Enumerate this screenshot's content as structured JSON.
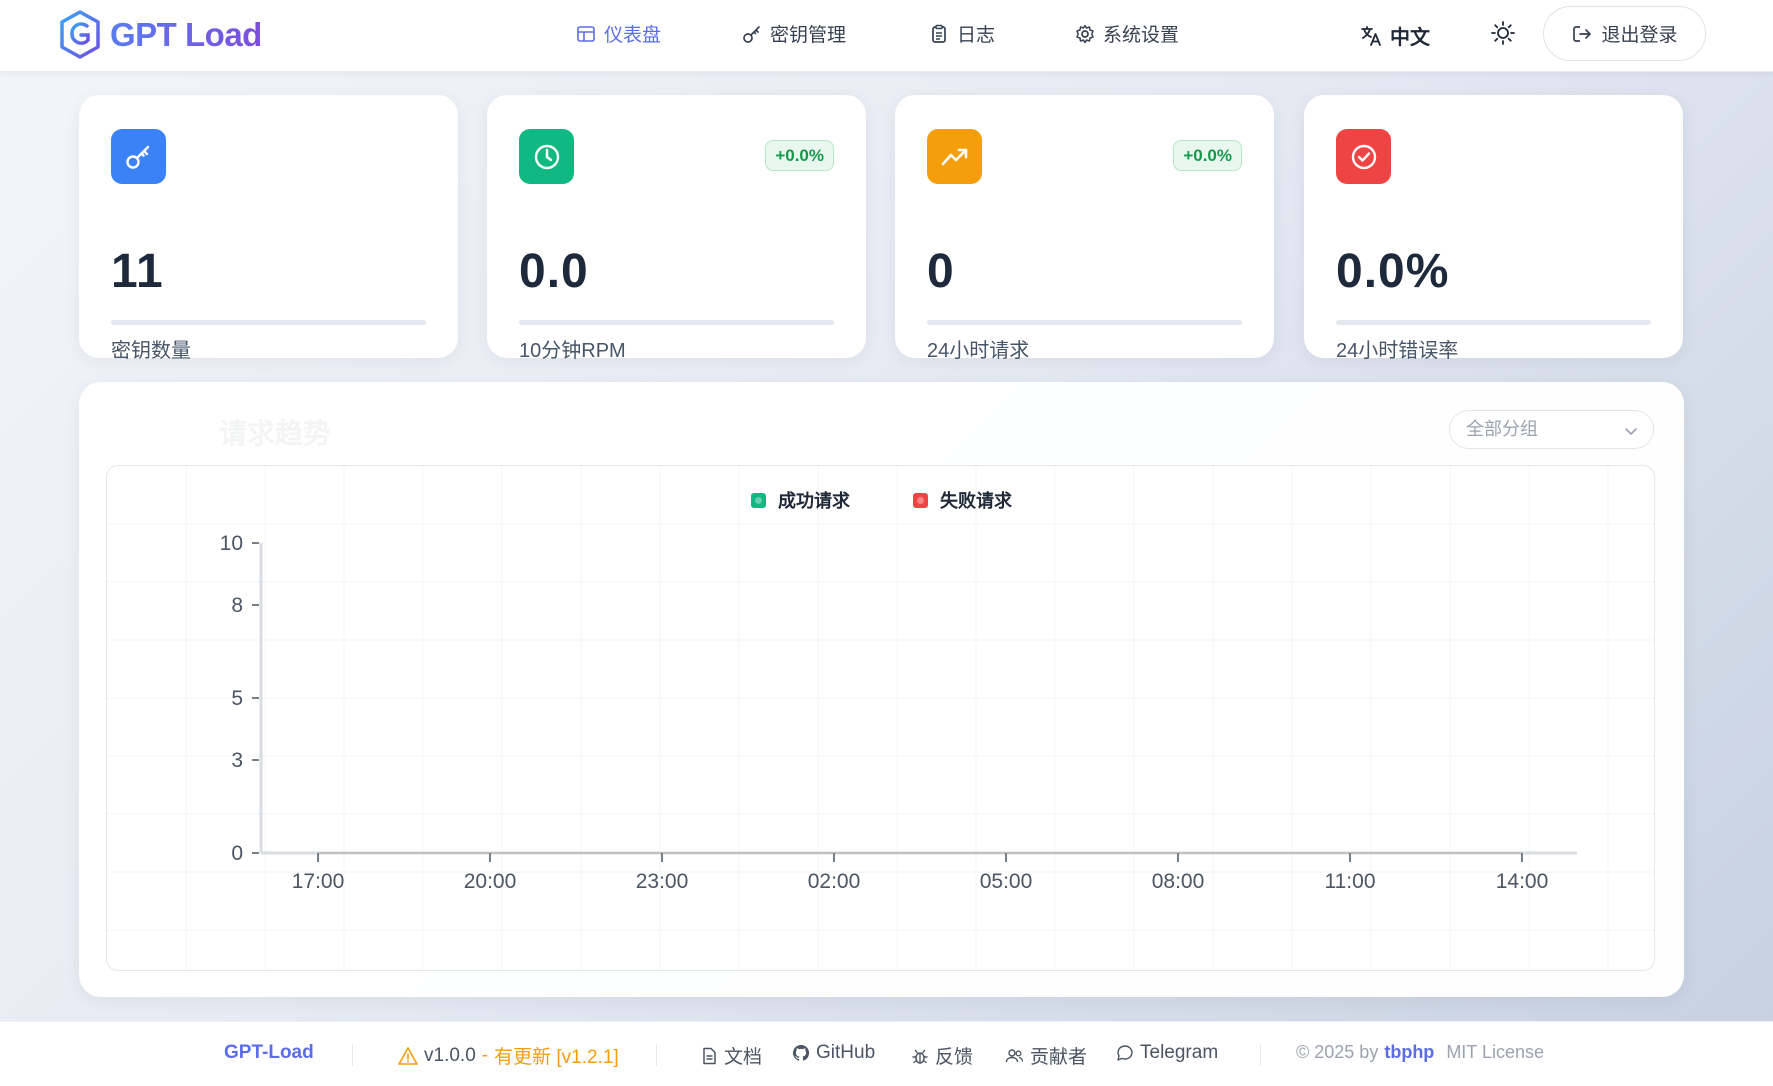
{
  "app": {
    "name": "GPT Load"
  },
  "nav": {
    "items": [
      {
        "label": "仪表盘",
        "icon": "dashboard-icon",
        "active": true
      },
      {
        "label": "密钥管理",
        "icon": "key-icon",
        "active": false
      },
      {
        "label": "日志",
        "icon": "clipboard-icon",
        "active": false
      },
      {
        "label": "系统设置",
        "icon": "gear-icon",
        "active": false
      }
    ],
    "language": "中文",
    "logout": "退出登录"
  },
  "stats": [
    {
      "value": "11",
      "label": "密钥数量",
      "icon": "key-icon",
      "color": "#3b82f6",
      "trend": ""
    },
    {
      "value": "0.0",
      "label": "10分钟RPM",
      "icon": "clock-icon",
      "color": "#10b981",
      "trend": "+0.0%"
    },
    {
      "value": "0",
      "label": "24小时请求",
      "icon": "trend-up-icon",
      "color": "#f59e0b",
      "trend": "+0.0%"
    },
    {
      "value": "0.0%",
      "label": "24小时错误率",
      "icon": "check-circle-icon",
      "color": "#ef4444",
      "trend": ""
    }
  ],
  "panel": {
    "title": "请求趋势",
    "group_select": "全部分组"
  },
  "chart_data": {
    "type": "line",
    "x": [
      "17:00",
      "20:00",
      "23:00",
      "02:00",
      "05:00",
      "08:00",
      "11:00",
      "14:00"
    ],
    "series": [
      {
        "name": "成功请求",
        "color": "#10b981",
        "values": [
          0,
          0,
          0,
          0,
          0,
          0,
          0,
          0
        ]
      },
      {
        "name": "失败请求",
        "color": "#ef4444",
        "values": [
          0,
          0,
          0,
          0,
          0,
          0,
          0,
          0
        ]
      }
    ],
    "yticks": [
      "0",
      "3",
      "5",
      "8",
      "10"
    ],
    "ylim": [
      0,
      10
    ],
    "legend": "top-center",
    "grid": true
  },
  "footer": {
    "brand": "GPT-Load",
    "version": "v1.0.0",
    "dash": "-",
    "update": "有更新 [v1.2.1]",
    "links": [
      "文档",
      "GitHub",
      "反馈",
      "贡献者",
      "Telegram"
    ],
    "copyright": "© 2025 by",
    "author": "tbphp",
    "license": "MIT License"
  }
}
